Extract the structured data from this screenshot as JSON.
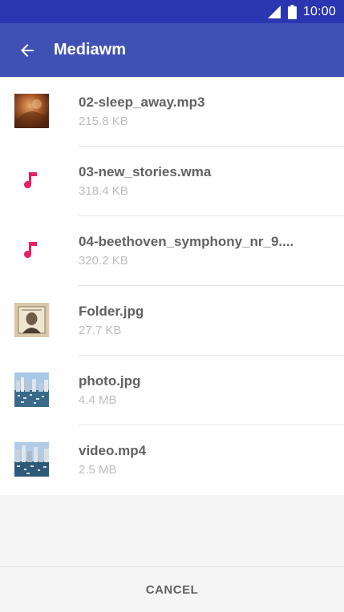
{
  "status_bar": {
    "time": "10:00",
    "icons": [
      "signal-icon",
      "battery-icon"
    ]
  },
  "app_bar": {
    "title": "Mediawm",
    "back_icon": "arrow-back-icon"
  },
  "files": [
    {
      "name": "02-sleep_away.mp3",
      "size": "215.8 KB",
      "icon": "album-art-thumbnail"
    },
    {
      "name": "03-new_stories.wma",
      "size": "318.4 KB",
      "icon": "music-note-icon"
    },
    {
      "name": "04-beethoven_symphony_nr_9....",
      "size": "320.2 KB",
      "icon": "music-note-icon"
    },
    {
      "name": "Folder.jpg",
      "size": "27.7 KB",
      "icon": "image-thumbnail"
    },
    {
      "name": "photo.jpg",
      "size": "4.4 MB",
      "icon": "image-thumbnail"
    },
    {
      "name": "video.mp4",
      "size": "2.5 MB",
      "icon": "video-thumbnail"
    }
  ],
  "footer": {
    "cancel_label": "CANCEL"
  },
  "colors": {
    "status_bar": "#2a36b0",
    "app_bar": "#3f51b5",
    "music_icon": "#e91e63"
  }
}
